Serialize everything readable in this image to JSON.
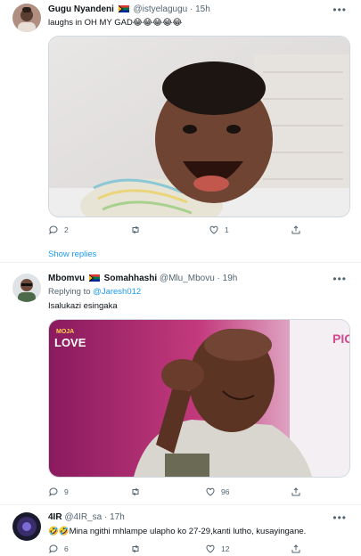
{
  "tweets": [
    {
      "name": "Gugu Nyandeni",
      "handle": "@istyelagugu",
      "dot": "·",
      "time": "15h",
      "text": "laughs in OH MY GAD😂😂😂😂😂",
      "replies": "2",
      "retweets": "",
      "likes": "1",
      "show_replies": "Show replies"
    },
    {
      "name": "Mbomvu",
      "name_suffix": "Somahhashi",
      "handle": "@Mlu_Mbovu",
      "dot": "·",
      "time": "19h",
      "replying_label": "Replying to",
      "replying_to": "@Jaresh012",
      "text": "Isalukazi esingaka",
      "media_badge": "MOJA LOVE",
      "media_badge_top": "MOJA",
      "media_badge_bottom": "LOVE",
      "media_corner_text": "PIG",
      "replies": "9",
      "retweets": "",
      "likes": "96"
    },
    {
      "name": "4IR",
      "handle": "@4IR_sa",
      "dot": "·",
      "time": "17h",
      "text": "🤣🤣Mina ngithi mhlampe ulapho ko 27-29,kanti lutho, kusayingane.",
      "replies": "6",
      "retweets": "",
      "likes": "12"
    }
  ],
  "more_glyph": "•••",
  "icons": [
    "reply-icon",
    "retweet-icon",
    "like-icon",
    "share-icon",
    "more-icon",
    "south-africa-flag-icon"
  ],
  "colors": {
    "link": "#1d9bf0",
    "secondary": "#536471",
    "primary": "#0f1419",
    "divider": "#eff3f4"
  }
}
